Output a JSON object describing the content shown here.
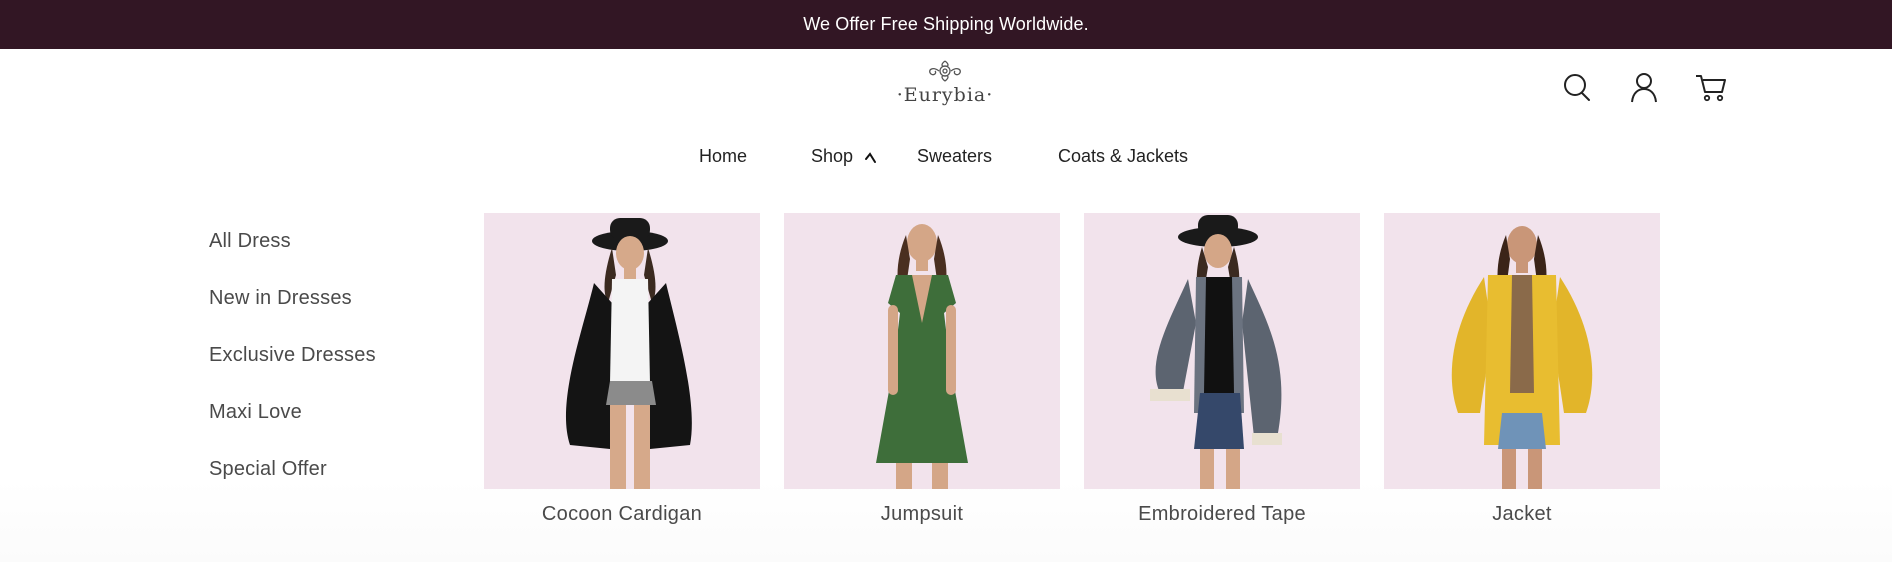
{
  "announcement": "We Offer Free Shipping Worldwide.",
  "brand": {
    "name": "·Eurybia·"
  },
  "header_icons": [
    "search-icon",
    "account-icon",
    "cart-icon"
  ],
  "nav": {
    "items": [
      {
        "label": "Home"
      },
      {
        "label": "Shop"
      },
      {
        "label": "Sweaters"
      },
      {
        "label": "Coats & Jackets"
      }
    ]
  },
  "mega_menu": {
    "categories": [
      "All Dress",
      "New in Dresses",
      "Exclusive Dresses",
      "Maxi Love",
      "Special Offer"
    ],
    "products": [
      {
        "title": "Cocoon Cardigan"
      },
      {
        "title": "Jumpsuit"
      },
      {
        "title": "Embroidered Tape"
      },
      {
        "title": "Jacket"
      }
    ]
  },
  "colors": {
    "topbar": "#321624",
    "thumb_bg": "#f2e3ec"
  }
}
